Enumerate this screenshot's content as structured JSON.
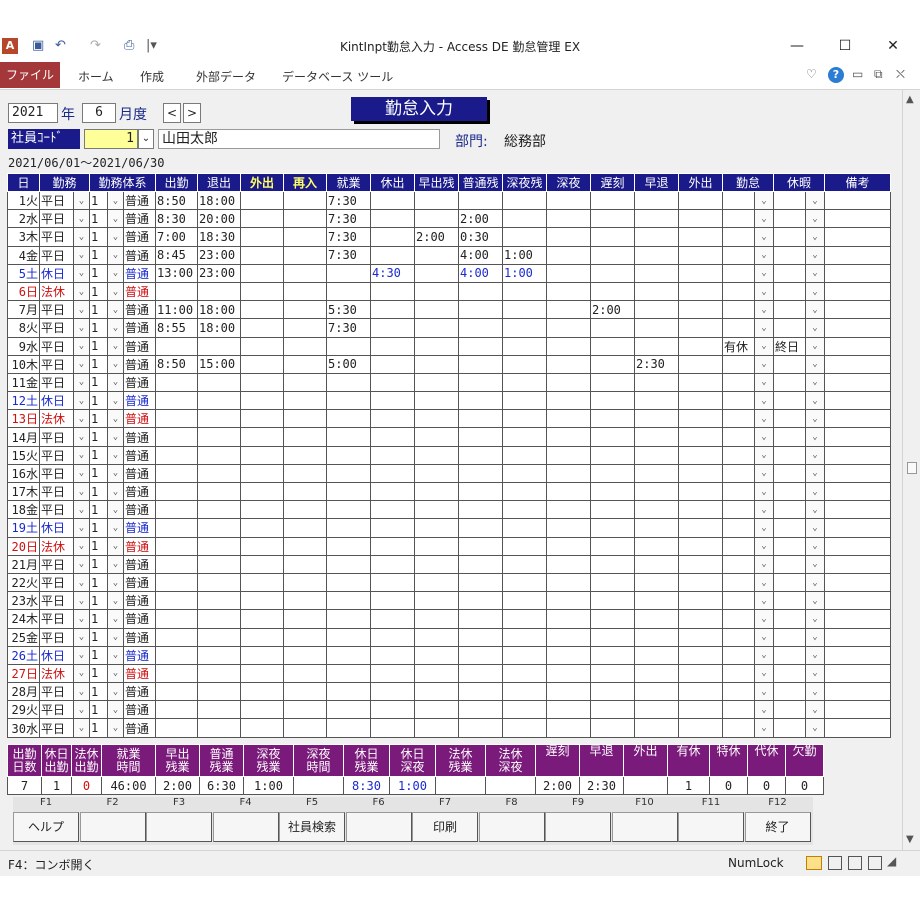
{
  "window": {
    "title": "KintInpt勤怠入力 - Access DE 勤怠管理 EX",
    "min": "—",
    "max": "☐",
    "close": "✕"
  },
  "quickaccess": {
    "save": "▣",
    "undo": "↶",
    "redo": "↷",
    "preview": "⎙",
    "more": "|▾"
  },
  "ribbon": {
    "tabs": [
      "ファイル",
      "ホーム",
      "作成",
      "外部データ",
      "データベース ツール"
    ],
    "icons": [
      "♡",
      "?",
      "▭",
      "⧉",
      "⛌"
    ]
  },
  "form": {
    "year": "2021",
    "year_suffix": "年",
    "month": "6",
    "month_suffix": "月度",
    "prev": "<",
    "next": ">",
    "title": "勤怠入力",
    "emp_label": "社員ｺｰﾄﾞ",
    "emp_code": "1",
    "emp_dd": "⌄",
    "emp_name": "山田太郎",
    "dept_label": "部門:",
    "dept": "総務部",
    "range": "2021/06/01～2021/06/30"
  },
  "grid": {
    "headers": [
      "日",
      "勤務",
      "勤務体系",
      "",
      "出勤",
      "退出",
      "外出",
      "再入",
      "就業",
      "休出",
      "早出残",
      "普通残",
      "深夜残",
      "深夜",
      "遅刻",
      "早退",
      "外出",
      "勤怠",
      "",
      "休暇",
      "",
      "備考"
    ],
    "rows": [
      {
        "day": "1火",
        "kind": "平日",
        "ct": "1",
        "sys": "普通",
        "in": "8:50",
        "out": "18:00",
        "work": "7:30",
        "c": ""
      },
      {
        "day": "2水",
        "kind": "平日",
        "ct": "1",
        "sys": "普通",
        "in": "8:30",
        "out": "20:00",
        "work": "7:30",
        "normal": "2:00",
        "c": ""
      },
      {
        "day": "3木",
        "kind": "平日",
        "ct": "1",
        "sys": "普通",
        "in": "7:00",
        "out": "18:30",
        "work": "7:30",
        "early": "2:00",
        "normal": "0:30",
        "c": ""
      },
      {
        "day": "4金",
        "kind": "平日",
        "ct": "1",
        "sys": "普通",
        "in": "8:45",
        "out": "23:00",
        "work": "7:30",
        "normal": "4:00",
        "lnight": "1:00",
        "c": ""
      },
      {
        "day": "5土",
        "kind": "休日",
        "ct": "1",
        "sys": "普通",
        "in": "13:00",
        "out": "23:00",
        "hol": "4:30",
        "normal": "4:00",
        "lnight": "1:00",
        "c": "blue"
      },
      {
        "day": "6日",
        "kind": "法休",
        "ct": "1",
        "sys": "普通",
        "c": "red"
      },
      {
        "day": "7月",
        "kind": "平日",
        "ct": "1",
        "sys": "普通",
        "in": "11:00",
        "out": "18:00",
        "work": "5:30",
        "late": "2:00",
        "c": ""
      },
      {
        "day": "8火",
        "kind": "平日",
        "ct": "1",
        "sys": "普通",
        "in": "8:55",
        "out": "18:00",
        "work": "7:30",
        "c": ""
      },
      {
        "day": "9水",
        "kind": "平日",
        "ct": "1",
        "sys": "普通",
        "kintai": "有休",
        "kyuka": "終日",
        "c": ""
      },
      {
        "day": "10木",
        "kind": "平日",
        "ct": "1",
        "sys": "普通",
        "in": "8:50",
        "out": "15:00",
        "work": "5:00",
        "leave": "2:30",
        "c": ""
      },
      {
        "day": "11金",
        "kind": "平日",
        "ct": "1",
        "sys": "普通",
        "c": ""
      },
      {
        "day": "12土",
        "kind": "休日",
        "ct": "1",
        "sys": "普通",
        "c": "blue"
      },
      {
        "day": "13日",
        "kind": "法休",
        "ct": "1",
        "sys": "普通",
        "c": "red"
      },
      {
        "day": "14月",
        "kind": "平日",
        "ct": "1",
        "sys": "普通",
        "c": ""
      },
      {
        "day": "15火",
        "kind": "平日",
        "ct": "1",
        "sys": "普通",
        "c": ""
      },
      {
        "day": "16水",
        "kind": "平日",
        "ct": "1",
        "sys": "普通",
        "c": ""
      },
      {
        "day": "17木",
        "kind": "平日",
        "ct": "1",
        "sys": "普通",
        "c": ""
      },
      {
        "day": "18金",
        "kind": "平日",
        "ct": "1",
        "sys": "普通",
        "c": ""
      },
      {
        "day": "19土",
        "kind": "休日",
        "ct": "1",
        "sys": "普通",
        "c": "blue"
      },
      {
        "day": "20日",
        "kind": "法休",
        "ct": "1",
        "sys": "普通",
        "c": "red"
      },
      {
        "day": "21月",
        "kind": "平日",
        "ct": "1",
        "sys": "普通",
        "c": ""
      },
      {
        "day": "22火",
        "kind": "平日",
        "ct": "1",
        "sys": "普通",
        "c": ""
      },
      {
        "day": "23水",
        "kind": "平日",
        "ct": "1",
        "sys": "普通",
        "c": ""
      },
      {
        "day": "24木",
        "kind": "平日",
        "ct": "1",
        "sys": "普通",
        "c": ""
      },
      {
        "day": "25金",
        "kind": "平日",
        "ct": "1",
        "sys": "普通",
        "c": ""
      },
      {
        "day": "26土",
        "kind": "休日",
        "ct": "1",
        "sys": "普通",
        "c": "blue"
      },
      {
        "day": "27日",
        "kind": "法休",
        "ct": "1",
        "sys": "普通",
        "c": "red"
      },
      {
        "day": "28月",
        "kind": "平日",
        "ct": "1",
        "sys": "普通",
        "c": ""
      },
      {
        "day": "29火",
        "kind": "平日",
        "ct": "1",
        "sys": "普通",
        "c": ""
      },
      {
        "day": "30水",
        "kind": "平日",
        "ct": "1",
        "sys": "普通",
        "c": ""
      }
    ]
  },
  "summary": {
    "headers": [
      "出勤\n日数",
      "休日\n出勤",
      "法休\n出勤",
      "就業\n時間",
      "早出\n残業",
      "普通\n残業",
      "深夜\n残業",
      "深夜\n時間",
      "休日\n残業",
      "休日\n深夜",
      "法休\n残業",
      "法休\n深夜",
      "遅刻",
      "早退",
      "外出",
      "有休",
      "特休",
      "代休",
      "欠勤"
    ],
    "values": [
      "7",
      "1",
      "0",
      "46:00",
      "2:00",
      "6:30",
      "1:00",
      "",
      "8:30",
      "1:00",
      "",
      "",
      "2:00",
      "2:30",
      "",
      "1",
      "0",
      "0",
      "0"
    ]
  },
  "fkeys": [
    {
      "key": "F1",
      "label": "ヘルプ"
    },
    {
      "key": "F2",
      "label": ""
    },
    {
      "key": "F3",
      "label": ""
    },
    {
      "key": "F4",
      "label": ""
    },
    {
      "key": "F5",
      "label": "社員検索"
    },
    {
      "key": "F6",
      "label": ""
    },
    {
      "key": "F7",
      "label": "印刷"
    },
    {
      "key": "F8",
      "label": ""
    },
    {
      "key": "F9",
      "label": ""
    },
    {
      "key": "F10",
      "label": ""
    },
    {
      "key": "F11",
      "label": ""
    },
    {
      "key": "F12",
      "label": "終了"
    }
  ],
  "status": {
    "hint": "F4：コンボ開く",
    "numlock": "NumLock"
  }
}
